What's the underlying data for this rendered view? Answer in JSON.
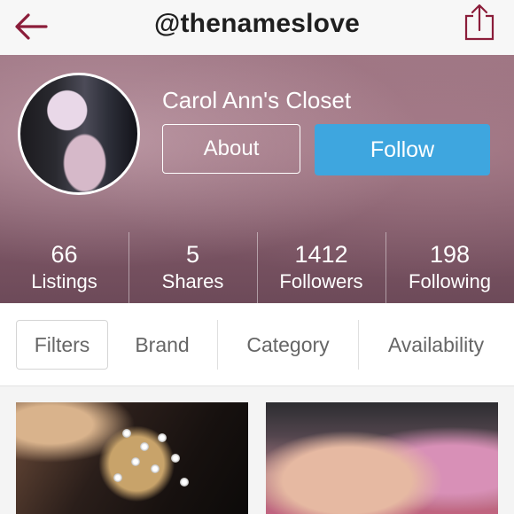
{
  "nav": {
    "title": "@thenameslove",
    "back_icon": "back-arrow-icon",
    "share_icon": "share-icon"
  },
  "colors": {
    "accent": "#3ea6df",
    "back_arrow": "#8b1d3a"
  },
  "profile": {
    "store_name": "Carol Ann's Closet",
    "about_label": "About",
    "follow_label": "Follow"
  },
  "stats": [
    {
      "value": "66",
      "label": "Listings"
    },
    {
      "value": "5",
      "label": "Shares"
    },
    {
      "value": "1412",
      "label": "Followers"
    },
    {
      "value": "198",
      "label": "Following"
    }
  ],
  "filters": {
    "filters_label": "Filters",
    "tabs": [
      "Brand",
      "Category",
      "Availability"
    ]
  }
}
